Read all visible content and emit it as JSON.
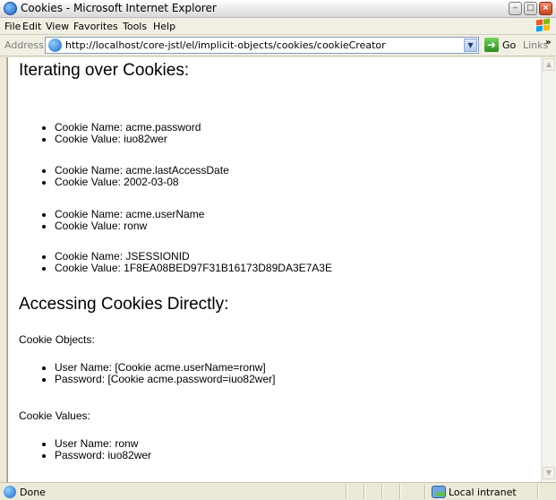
{
  "window": {
    "title": "Cookies - Microsoft Internet Explorer"
  },
  "menu": {
    "items": [
      "File",
      "Edit",
      "View",
      "Favorites",
      "Tools",
      "Help"
    ]
  },
  "address": {
    "label": "Address",
    "url": "http://localhost/core-jstl/el/implicit-objects/cookies/cookieCreator",
    "go_label": "Go",
    "links_label": "Links",
    "links_chevron": "»"
  },
  "page": {
    "heading1": "Iterating over Cookies:",
    "cookies": [
      {
        "name": "Cookie Name: acme.password",
        "value": "Cookie Value: iuo82wer"
      },
      {
        "name": "Cookie Name: acme.lastAccessDate",
        "value": "Cookie Value: 2002-03-08"
      },
      {
        "name": "Cookie Name: acme.userName",
        "value": "Cookie Value: ronw"
      },
      {
        "name": "Cookie Name: JSESSIONID",
        "value": "Cookie Value: 1F8EA08BED97F31B16173D89DA3E7A3E"
      }
    ],
    "heading2": "Accessing Cookies Directly:",
    "objects_label": "Cookie Objects:",
    "objects": [
      "User Name: [Cookie acme.userName=ronw]",
      "Password: [Cookie acme.password=iuo82wer]"
    ],
    "values_label": "Cookie Values:",
    "values": [
      "User Name: ronw",
      "Password: iuo82wer"
    ]
  },
  "status": {
    "text": "Done",
    "zone": "Local intranet"
  },
  "icons": {
    "title": "ie-icon",
    "address": "ie-page-icon",
    "go": "go-arrow-icon",
    "status": "ie-page-icon",
    "zone": "local-intranet-icon",
    "logo": "windows-logo-icon"
  }
}
